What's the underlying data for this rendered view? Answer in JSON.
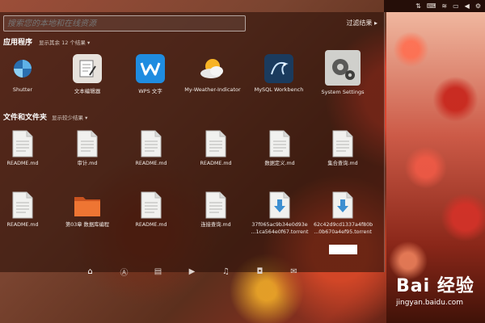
{
  "search": {
    "placeholder": "搜索您的本地和在线资源",
    "filter_label": "过滤结果"
  },
  "apps_section": {
    "title": "应用程序",
    "hint": "显示其余 12 个结果",
    "items": [
      {
        "label": "Shutter",
        "icon": "shutter-icon"
      },
      {
        "label": "文本编辑器",
        "icon": "text-editor-icon"
      },
      {
        "label": "WPS 文字",
        "icon": "wps-writer-icon"
      },
      {
        "label": "My-Weather-Indicator",
        "icon": "weather-icon"
      },
      {
        "label": "MySQL Workbench",
        "icon": "mysql-workbench-icon"
      },
      {
        "label": "System Settings",
        "icon": "system-settings-icon"
      }
    ]
  },
  "files_section": {
    "title": "文件和文件夹",
    "hint": "显示较少结果",
    "row1": [
      {
        "label": "README.md"
      },
      {
        "label": "审计.md"
      },
      {
        "label": "README.md"
      },
      {
        "label": "README.md"
      },
      {
        "label": "数据定义.md"
      },
      {
        "label": "集合查询.md"
      }
    ],
    "row2": [
      {
        "label": "README.md"
      },
      {
        "label": "第03章 数据库编程"
      },
      {
        "label": "README.md"
      },
      {
        "label": "连接查询.md"
      },
      {
        "label": "37f065ac9b34e0d93e",
        "label2": "...1ca564e0f67.torrent"
      },
      {
        "label": "62c42d9cd1337a4f80b",
        "label2": "...0b670a4ef95.torrent"
      }
    ]
  },
  "lenses": [
    "home-lens-icon",
    "applications-lens-icon",
    "files-lens-icon",
    "video-lens-icon",
    "music-lens-icon",
    "photos-lens-icon",
    "social-lens-icon"
  ],
  "topbar": {
    "indicators": [
      "network-icon",
      "keyboard-icon",
      "wifi-icon",
      "battery-icon",
      "volume-icon",
      "settings-icon"
    ]
  },
  "watermark": {
    "logo": "Bai 经验",
    "url": "jingyan.baidu.com"
  },
  "colors": {
    "accent": "#e15b3e",
    "panel": "#2d120a"
  }
}
